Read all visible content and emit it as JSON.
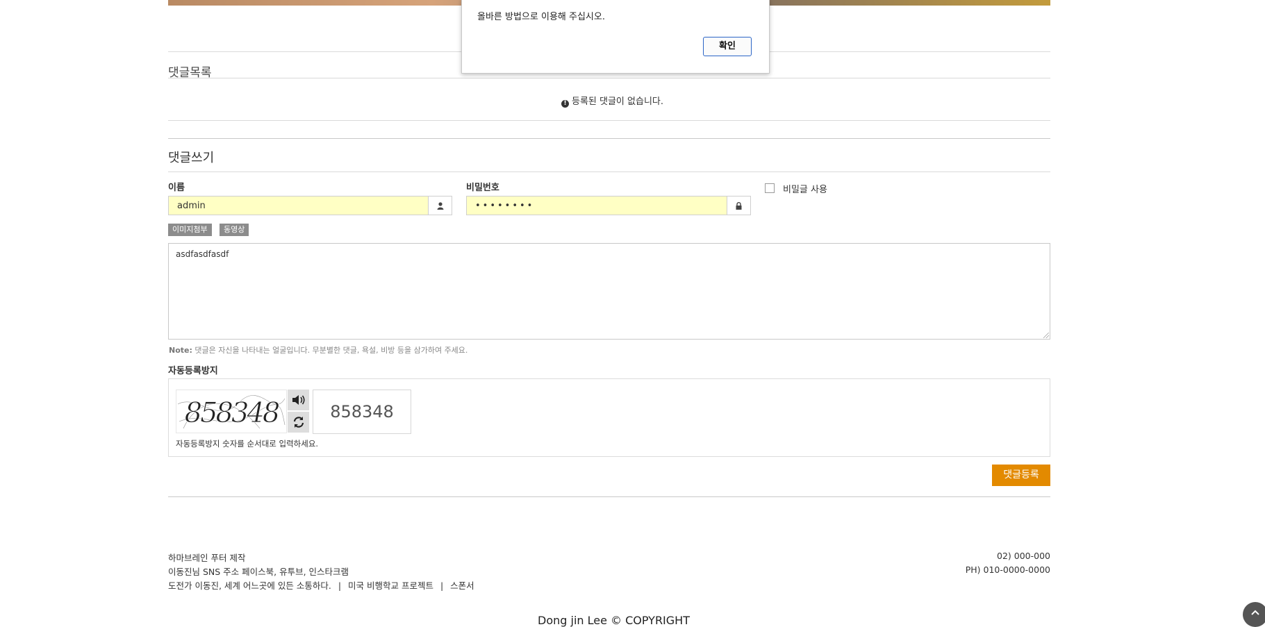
{
  "comments": {
    "list_title": "댓글목록",
    "empty_message": "등록된 댓글이 없습니다."
  },
  "write": {
    "title": "댓글쓰기",
    "name_label": "이름",
    "name_value": "admin",
    "password_label": "비밀번호",
    "password_value": "••••••••",
    "secret_label": "비밀글 사용",
    "secret_checked": false,
    "image_attach_label": "이미지첨부",
    "video_label": "동영상",
    "content_value": "asdfasdfasdf",
    "note_prefix": "Note:",
    "note_text": "댓글은 자신을 나타내는 얼굴입니다. 무분별한 댓글, 욕설, 비방 등을 삼가하여 주세요.",
    "submit_label": "댓글등록"
  },
  "captcha": {
    "title": "자동등록방지",
    "image_text": "858348",
    "input_value": "858348",
    "help_text": "자동등록방지 숫자를 순서대로 입력하세요."
  },
  "footer": {
    "line1": "하마브레인 푸터 제작",
    "line2": "이동진님 SNS 주소 페이스북, 유투브, 인스타크램",
    "line3_a": "도전가 이동진, 세계 어느곳에 있든 소통하다.",
    "line3_sep": "|",
    "line3_b": "미국 비행학교 프로젝트",
    "line3_c": "스폰서",
    "phone": "02) 000-000",
    "mobile": "PH) 010-0000-0000",
    "copyright": "Dong jin Lee © COPYRIGHT"
  },
  "alert": {
    "message": "올바른 방법으로 이용해 주십시오.",
    "ok_label": "확인"
  },
  "colors": {
    "accent": "#e38a00",
    "autofill": "#ffffc4",
    "dialog_button_border": "#2a64c6"
  }
}
